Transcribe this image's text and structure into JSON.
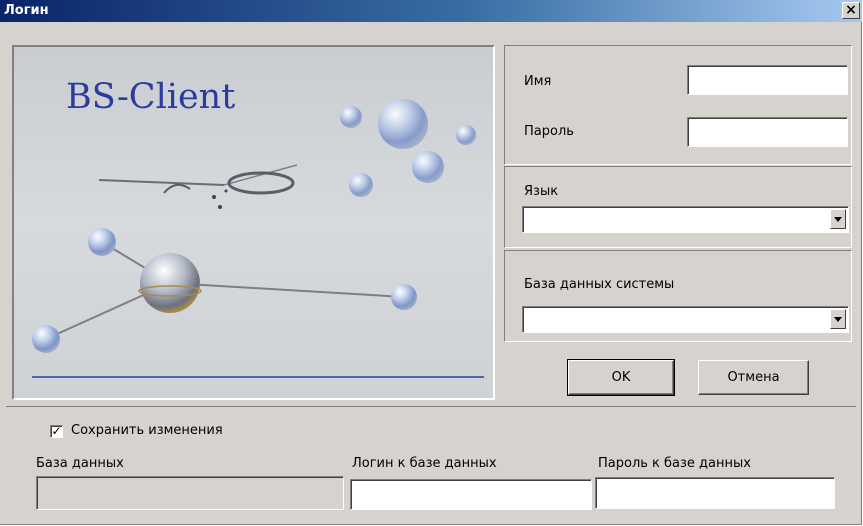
{
  "window": {
    "title": "Логин",
    "close_glyph": "×"
  },
  "splash": {
    "title": "BS-Client",
    "accent_color": "#2a3d9c"
  },
  "login": {
    "name_label": "Имя",
    "name_value": "",
    "password_label": "Пароль",
    "password_value": ""
  },
  "language": {
    "label": "Язык",
    "selected": ""
  },
  "system_db": {
    "label": "База данных системы",
    "selected": ""
  },
  "buttons": {
    "ok": "OK",
    "cancel": "Отмена"
  },
  "options": {
    "save_changes_label": "Сохранить изменения",
    "save_changes_checked": true,
    "check_glyph": "✓"
  },
  "db_fields": {
    "database_label": "База данных",
    "database_value": "",
    "db_login_label": "Логин к базе данных",
    "db_login_value": "",
    "db_password_label": "Пароль к базе данных",
    "db_password_value": ""
  }
}
